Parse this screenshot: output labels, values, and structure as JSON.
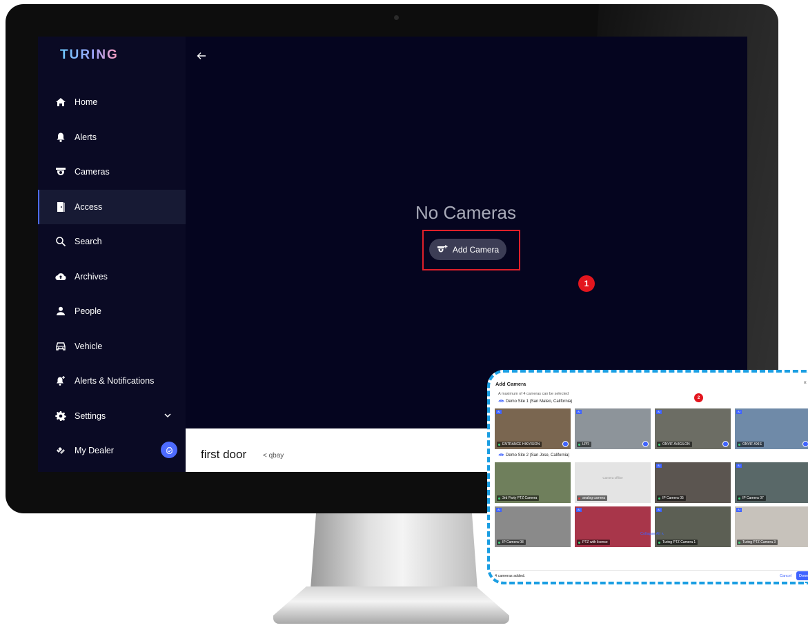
{
  "app": {
    "brand": "TURING"
  },
  "sidebar": {
    "items": [
      {
        "label": "Home",
        "icon": "home-icon"
      },
      {
        "label": "Alerts",
        "icon": "bell-icon"
      },
      {
        "label": "Cameras",
        "icon": "camera-icon"
      },
      {
        "label": "Access",
        "icon": "door-icon",
        "active": true
      },
      {
        "label": "Search",
        "icon": "search-icon"
      },
      {
        "label": "Archives",
        "icon": "cloud-upload-icon"
      },
      {
        "label": "People",
        "icon": "person-icon"
      },
      {
        "label": "Vehicle",
        "icon": "car-icon"
      },
      {
        "label": "Alerts & Notifications",
        "icon": "bell-plus-icon"
      },
      {
        "label": "Settings",
        "icon": "gear-icon"
      },
      {
        "label": "My Dealer",
        "icon": "dealer-icon"
      }
    ]
  },
  "main": {
    "empty_title": "No Cameras",
    "add_camera_label": "Add Camera",
    "step_badge": "1"
  },
  "door_panel": {
    "name": "first door",
    "site": "qbay",
    "separator": "<"
  },
  "popup": {
    "title": "Add Camera",
    "close": "×",
    "hint": "A maximum of 4 cameras can be selected",
    "step_badge": "2",
    "sites": [
      {
        "name": "Demo Site 1 (San Mateo, California)",
        "cameras": [
          {
            "label": "ENTRANCE HIKVISION",
            "tag": "AI",
            "selected": true,
            "online": true,
            "bg": "#7a6650"
          },
          {
            "label": "LPR",
            "tag": "AI",
            "selected": true,
            "online": true,
            "bg": "#8d949a"
          },
          {
            "label": "ONVIF AVIGILON",
            "tag": "AI",
            "selected": true,
            "online": true,
            "bg": "#6c6d64"
          },
          {
            "label": "ONVIF AXIS",
            "tag": "AI",
            "selected": true,
            "online": true,
            "bg": "#6f8aa8"
          }
        ]
      },
      {
        "name": "Demo Site 2 (San Jose, California)",
        "cameras": [
          {
            "label": "3rd Party PTZ Camera",
            "tag": "",
            "selected": false,
            "online": true,
            "bg": "#6f7f5c"
          },
          {
            "label": "analog camera",
            "tag": "",
            "selected": false,
            "online": false,
            "bg": "#e4e4e4",
            "offline_text": "Camera offline"
          },
          {
            "label": "IP Camera 05",
            "tag": "AI",
            "selected": false,
            "online": true,
            "bg": "#5b5550"
          },
          {
            "label": "IP Camera 07",
            "tag": "AI",
            "selected": false,
            "online": true,
            "bg": "#596868"
          },
          {
            "label": "IP Camera 08",
            "tag": "AI",
            "selected": false,
            "online": true,
            "bg": "#8a8a8a"
          },
          {
            "label": "PTZ with license",
            "tag": "AI",
            "selected": false,
            "online": true,
            "bg": "#a8364a"
          },
          {
            "label": "Turing PTZ Camera 1",
            "tag": "AI",
            "selected": false,
            "online": true,
            "bg": "#5c5f54"
          },
          {
            "label": "Turing PTZ Camera 3",
            "tag": "AI",
            "selected": false,
            "online": true,
            "bg": "#c7c2bb"
          }
        ]
      }
    ],
    "collapse_label": "Collapse All ∧",
    "footer": {
      "count_text": "4 cameras added.",
      "cancel": "Cancel",
      "done": "Done"
    }
  },
  "colors": {
    "accent": "#3f63ff",
    "highlight": "#e0202a",
    "popup_border": "#1a9ee2",
    "screen_bg": "#05051f"
  }
}
